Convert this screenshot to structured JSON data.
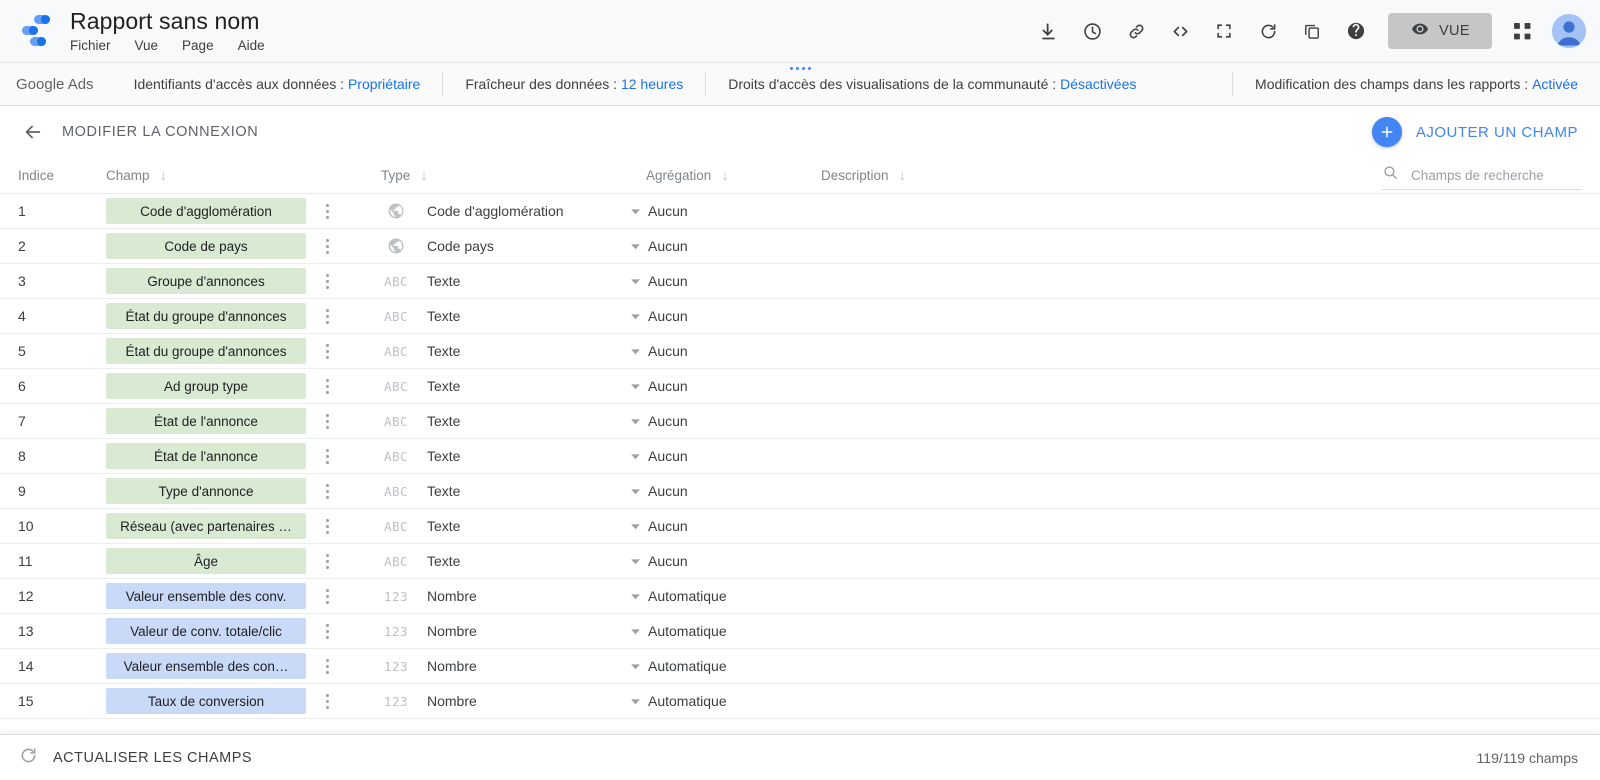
{
  "header": {
    "report_title": "Rapport sans nom",
    "logo_icon": "data-studio-logo",
    "menu": [
      {
        "label": "Fichier",
        "name": "menu-fichier"
      },
      {
        "label": "Vue",
        "name": "menu-vue"
      },
      {
        "label": "Page",
        "name": "menu-page"
      },
      {
        "label": "Aide",
        "name": "menu-aide"
      }
    ],
    "actions": [
      {
        "icon": "download-icon",
        "name": "download-button"
      },
      {
        "icon": "history-clock-icon",
        "name": "version-history-button"
      },
      {
        "icon": "link-icon",
        "name": "share-link-button"
      },
      {
        "icon": "embed-code-icon",
        "name": "embed-code-button"
      },
      {
        "icon": "fullscreen-icon",
        "name": "fullscreen-button"
      },
      {
        "icon": "refresh-icon",
        "name": "refresh-data-button"
      },
      {
        "icon": "copy-icon",
        "name": "make-a-copy-button"
      },
      {
        "icon": "help-icon",
        "name": "help-button"
      }
    ],
    "view_button": {
      "label": "VUE",
      "icon": "eye-icon"
    },
    "apps_grid_icon": "apps-grid-icon",
    "avatar_icon": "user-avatar"
  },
  "infobar": {
    "source": "Google Ads",
    "items": [
      {
        "label": "Identifiants d'accès aux données :",
        "value": "Propriétaire"
      },
      {
        "label": "Fraîcheur des données :",
        "value": "12 heures"
      },
      {
        "label": "Droits d'accès des visualisations de la communauté :",
        "value": "Désactivées"
      },
      {
        "label": "Modification des champs dans les rapports :",
        "value": "Activée"
      }
    ]
  },
  "actionbar": {
    "back_icon": "arrow-back-icon",
    "edit_connection_label": "MODIFIER LA CONNEXION",
    "add_field_label": "AJOUTER UN CHAMP",
    "add_field_icon": "plus-icon"
  },
  "table": {
    "columns": {
      "index": "Indice",
      "field": "Champ",
      "type": "Type",
      "aggregation": "Agrégation",
      "description": "Description"
    },
    "sort_icon": "arrow-down-icon",
    "search": {
      "icon": "search-icon",
      "placeholder": "Champs de recherche",
      "value": ""
    },
    "rows": [
      {
        "index": "1",
        "field": "Code d'agglomération",
        "kind": "dimension",
        "type_icon": "globe-icon",
        "type": "Code d'agglomération",
        "agg": "Aucun",
        "desc": ""
      },
      {
        "index": "2",
        "field": "Code de pays",
        "kind": "dimension",
        "type_icon": "globe-icon",
        "type": "Code pays",
        "agg": "Aucun",
        "desc": ""
      },
      {
        "index": "3",
        "field": "Groupe d'annonces",
        "kind": "dimension",
        "type_icon": "abc-icon",
        "type": "Texte",
        "agg": "Aucun",
        "desc": ""
      },
      {
        "index": "4",
        "field": "État du groupe d'annonces",
        "kind": "dimension",
        "type_icon": "abc-icon",
        "type": "Texte",
        "agg": "Aucun",
        "desc": ""
      },
      {
        "index": "5",
        "field": "État du groupe d'annonces",
        "kind": "dimension",
        "type_icon": "abc-icon",
        "type": "Texte",
        "agg": "Aucun",
        "desc": ""
      },
      {
        "index": "6",
        "field": "Ad group type",
        "kind": "dimension",
        "type_icon": "abc-icon",
        "type": "Texte",
        "agg": "Aucun",
        "desc": ""
      },
      {
        "index": "7",
        "field": "État de l'annonce",
        "kind": "dimension",
        "type_icon": "abc-icon",
        "type": "Texte",
        "agg": "Aucun",
        "desc": ""
      },
      {
        "index": "8",
        "field": "État de l'annonce",
        "kind": "dimension",
        "type_icon": "abc-icon",
        "type": "Texte",
        "agg": "Aucun",
        "desc": ""
      },
      {
        "index": "9",
        "field": "Type d'annonce",
        "kind": "dimension",
        "type_icon": "abc-icon",
        "type": "Texte",
        "agg": "Aucun",
        "desc": ""
      },
      {
        "index": "10",
        "field": "Réseau (avec partenaires …",
        "kind": "dimension",
        "type_icon": "abc-icon",
        "type": "Texte",
        "agg": "Aucun",
        "desc": ""
      },
      {
        "index": "11",
        "field": "Âge",
        "kind": "dimension",
        "type_icon": "abc-icon",
        "type": "Texte",
        "agg": "Aucun",
        "desc": ""
      },
      {
        "index": "12",
        "field": "Valeur ensemble des conv.",
        "kind": "metric",
        "type_icon": "123-icon",
        "type": "Nombre",
        "agg": "Automatique",
        "desc": ""
      },
      {
        "index": "13",
        "field": "Valeur de conv. totale/clic",
        "kind": "metric",
        "type_icon": "123-icon",
        "type": "Nombre",
        "agg": "Automatique",
        "desc": ""
      },
      {
        "index": "14",
        "field": "Valeur ensemble des con…",
        "kind": "metric",
        "type_icon": "123-icon",
        "type": "Nombre",
        "agg": "Automatique",
        "desc": ""
      },
      {
        "index": "15",
        "field": "Taux de conversion",
        "kind": "metric",
        "type_icon": "123-icon",
        "type": "Nombre",
        "agg": "Automatique",
        "desc": ""
      }
    ]
  },
  "bottombar": {
    "refresh_icon": "refresh-fields-icon",
    "refresh_label": "ACTUALISER LES CHAMPS",
    "count_label": "119/119 champs"
  },
  "colors": {
    "accent_blue": "#4285f4",
    "link_blue": "#1a73e8",
    "dimension_chip": "#d9ead3",
    "metric_chip": "#c9daf8",
    "text_primary": "#202124",
    "text_secondary": "#5f6368"
  }
}
